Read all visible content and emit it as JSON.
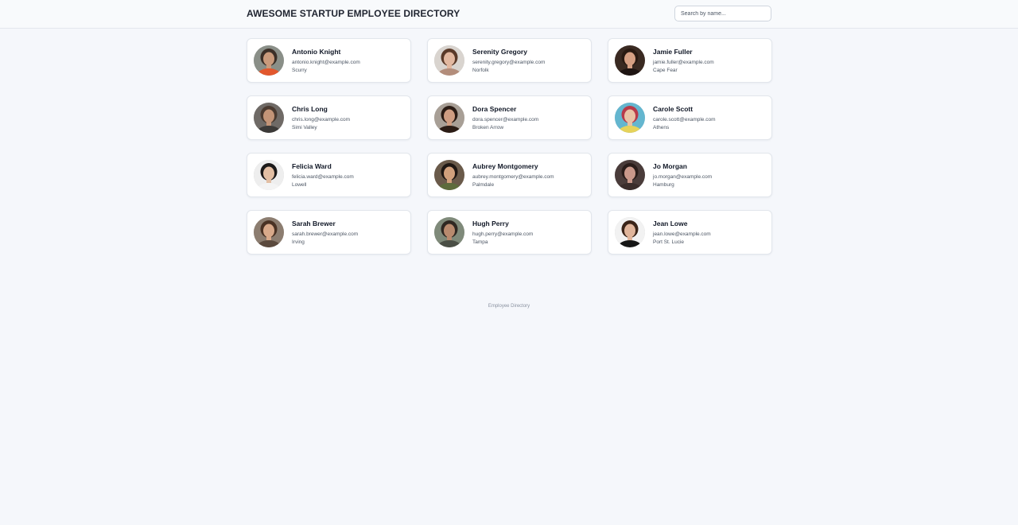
{
  "header": {
    "title": "AWESOME STARTUP EMPLOYEE DIRECTORY",
    "search_placeholder": "Search by name..."
  },
  "employees": [
    {
      "name": "Antonio Knight",
      "email": "antonio.knight@example.com",
      "city": "Scurry",
      "avatar": {
        "bg": "#8a8f88",
        "skin": "#c99a7c",
        "hair": "#3b2f28",
        "shirt": "#e2572d"
      }
    },
    {
      "name": "Serenity Gregory",
      "email": "serenity.gregory@example.com",
      "city": "Norfolk",
      "avatar": {
        "bg": "#d9d4cf",
        "skin": "#e2b8a0",
        "hair": "#5a3a29",
        "shirt": "#b38d7b"
      }
    },
    {
      "name": "Jamie Fuller",
      "email": "jamie.fuller@example.com",
      "city": "Cape Fear",
      "avatar": {
        "bg": "#3a2a22",
        "skin": "#d6a084",
        "hair": "#2a1a12",
        "shirt": "#1e1412"
      }
    },
    {
      "name": "Chris Long",
      "email": "chris.long@example.com",
      "city": "Simi Valley",
      "avatar": {
        "bg": "#6f6a66",
        "skin": "#c39477",
        "hair": "#4a3a30",
        "shirt": "#3c3a38"
      }
    },
    {
      "name": "Dora Spencer",
      "email": "dora.spencer@example.com",
      "city": "Broken Arrow",
      "avatar": {
        "bg": "#a89f96",
        "skin": "#cf9d82",
        "hair": "#2b1c15",
        "shirt": "#2b1c15"
      }
    },
    {
      "name": "Carole Scott",
      "email": "carole.scott@example.com",
      "city": "Athens",
      "avatar": {
        "bg": "#64b6cf",
        "skin": "#eac3a6",
        "hair": "#b83a4a",
        "shirt": "#e7d35a"
      }
    },
    {
      "name": "Felicia Ward",
      "email": "felicia.ward@example.com",
      "city": "Lowell",
      "avatar": {
        "bg": "#eeeeee",
        "skin": "#e3bfa4",
        "hair": "#1c1a1a",
        "shirt": "#f4f4f4"
      }
    },
    {
      "name": "Aubrey Montgomery",
      "email": "aubrey.montgomery@example.com",
      "city": "Palmdale",
      "avatar": {
        "bg": "#6a5a4a",
        "skin": "#d1a07c",
        "hair": "#1f1713",
        "shirt": "#5d6b3c"
      }
    },
    {
      "name": "Jo Morgan",
      "email": "jo.morgan@example.com",
      "city": "Hamburg",
      "avatar": {
        "bg": "#4a3c3a",
        "skin": "#c9988a",
        "hair": "#2a1d1a",
        "shirt": "#3a2d2b"
      }
    },
    {
      "name": "Sarah Brewer",
      "email": "sarah.brewer@example.com",
      "city": "Irving",
      "avatar": {
        "bg": "#8c7d70",
        "skin": "#d8a98a",
        "hair": "#4a3224",
        "shirt": "#5b4a3e"
      }
    },
    {
      "name": "Hugh Perry",
      "email": "hugh.perry@example.com",
      "city": "Tampa",
      "avatar": {
        "bg": "#7f8a7a",
        "skin": "#b88a6e",
        "hair": "#2f2822",
        "shirt": "#4a4e45"
      }
    },
    {
      "name": "Jean Lowe",
      "email": "jean.lowe@example.com",
      "city": "Port St. Lucie",
      "avatar": {
        "bg": "#f2f2f2",
        "skin": "#e0b59b",
        "hair": "#3a2418",
        "shirt": "#151515"
      }
    }
  ],
  "footer": {
    "text": "Employee Directory"
  }
}
